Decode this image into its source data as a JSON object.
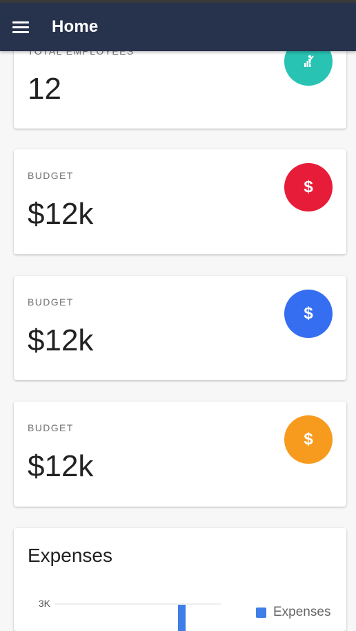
{
  "header": {
    "title": "Home"
  },
  "cards": [
    {
      "label": "TOTAL EMPLOYEES",
      "value": "12",
      "icon": "person-chart-icon",
      "color": "#29c3b3"
    },
    {
      "label": "BUDGET",
      "value": "$12k",
      "icon": "dollar-icon",
      "color": "#e71c38"
    },
    {
      "label": "BUDGET",
      "value": "$12k",
      "icon": "dollar-icon",
      "color": "#366ef2"
    },
    {
      "label": "BUDGET",
      "value": "$12k",
      "icon": "dollar-icon",
      "color": "#f79b1f"
    }
  ],
  "expenses": {
    "title": "Expenses",
    "legend": "Expenses",
    "y_tick": "3K"
  },
  "chart_data": {
    "type": "bar",
    "title": "Expenses",
    "series": [
      {
        "name": "Expenses",
        "values": [
          3000
        ]
      }
    ],
    "y_ticks": [
      "3K"
    ],
    "legend": "top-right",
    "grid": true
  }
}
